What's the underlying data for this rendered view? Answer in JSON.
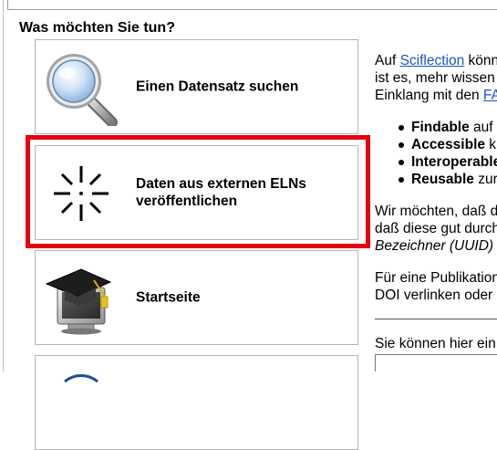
{
  "heading": "Was möchten Sie tun?",
  "options": [
    {
      "label": "Einen Datensatz suchen",
      "icon": "magnifier-icon"
    },
    {
      "label": "Daten aus externen ELNs veröffentlichen",
      "icon": "loading-spinner-icon"
    },
    {
      "label": "Startseite",
      "icon": "graduation-cap-monitor-icon"
    },
    {
      "label": "",
      "icon": "globe-icon"
    }
  ],
  "highlight_color": "#e3000f",
  "right_panel": {
    "line1_prefix": "Auf ",
    "line1_link": "Sciflection",
    "line1_suffix": " könn",
    "line2": "ist es, mehr wissen",
    "line3_prefix": "Einklang mit den ",
    "line3_link": "FA",
    "bullets": [
      {
        "bold": "Findable",
        "rest": " auf"
      },
      {
        "bold": "Accessible",
        "rest": " k"
      },
      {
        "bold": "Interoperable",
        "rest": ""
      },
      {
        "bold": "Reusable",
        "rest": " zur"
      }
    ],
    "para2_line1": "Wir möchten, daß d",
    "para2_line2": "daß diese gut durch",
    "para2_line3": "Bezeichner (UUID)",
    "para3_line1": "Für eine Publikation",
    "para3_line2": "DOI verlinken oder",
    "para4": "Sie können hier ein"
  }
}
